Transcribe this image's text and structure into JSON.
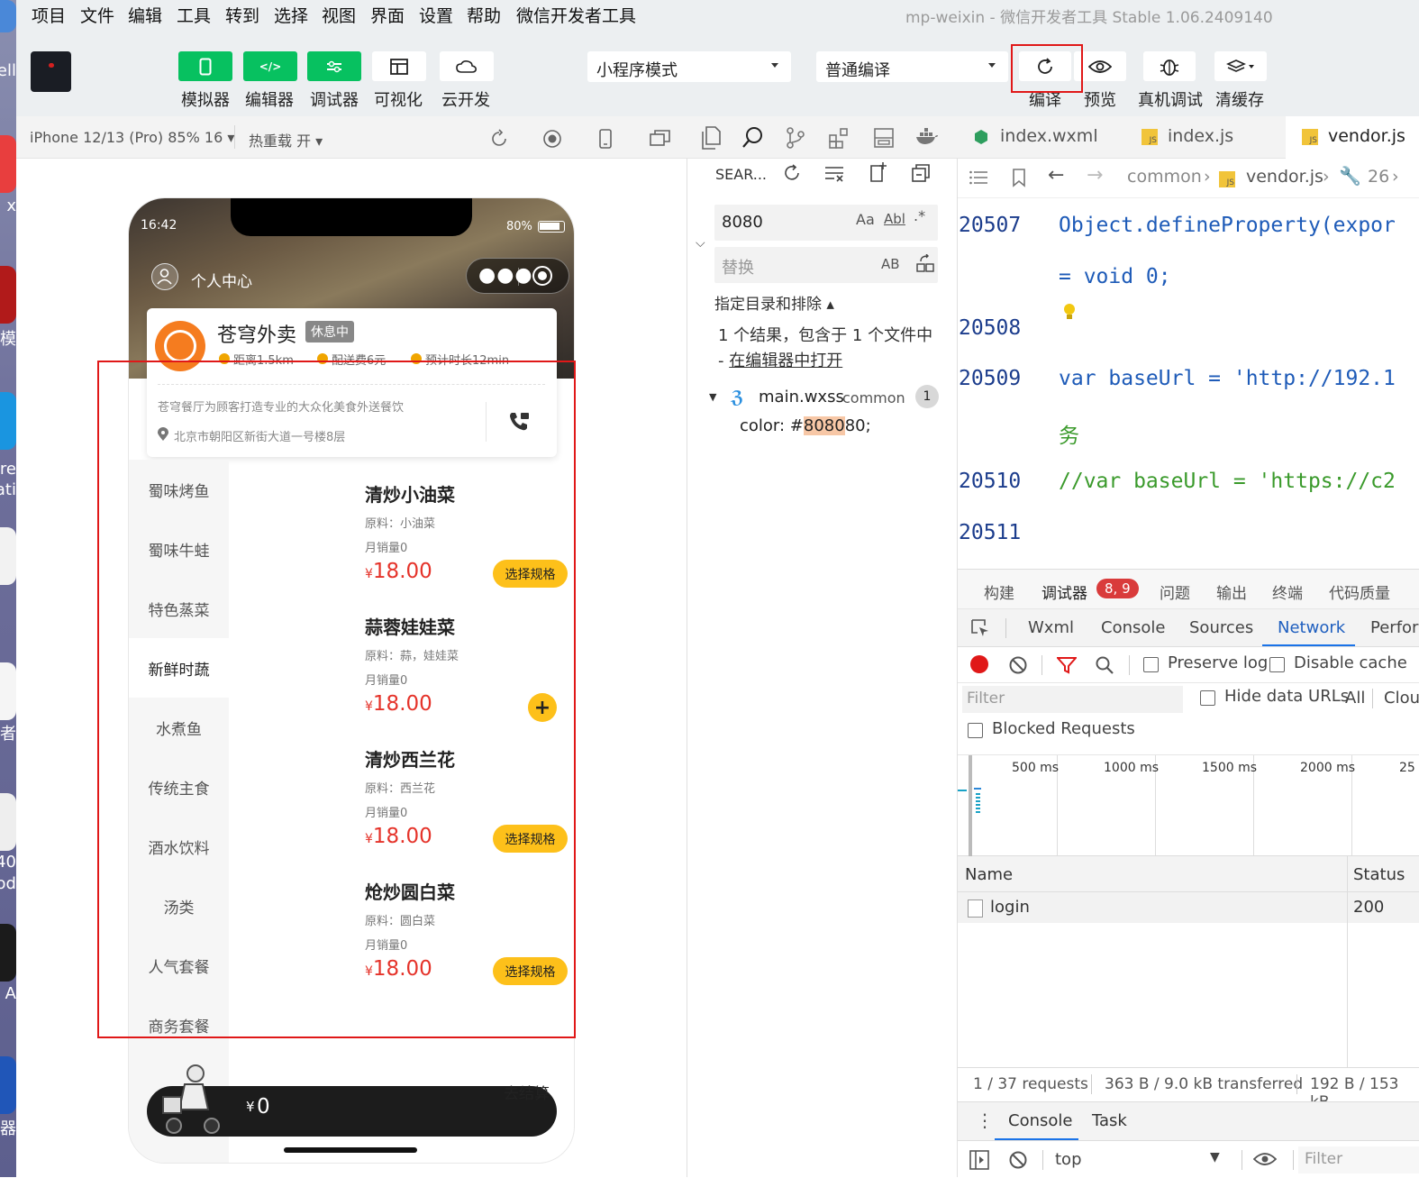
{
  "window": {
    "title": "mp-weixin - 微信开发者工具 Stable 1.06.2409140"
  },
  "menu": [
    "项目",
    "文件",
    "编辑",
    "工具",
    "转到",
    "选择",
    "视图",
    "界面",
    "设置",
    "帮助",
    "微信开发者工具"
  ],
  "dock": {
    "labels": [
      "ell",
      "x",
      "模",
      "re",
      "ati.",
      "者",
      "40",
      "od",
      "A",
      "器"
    ]
  },
  "toolbar": {
    "buttons": [
      "模拟器",
      "编辑器",
      "调试器",
      "可视化",
      "云开发"
    ],
    "mode_select": "小程序模式",
    "compile_select": "普通编译",
    "right_buttons": [
      "编译",
      "预览",
      "真机调试",
      "清缓存"
    ]
  },
  "simulator": {
    "device": "iPhone 12/13 (Pro) 85% 16",
    "hot_reload": "热重载 开",
    "status_time": "16:42",
    "battery": "80%",
    "nav_title": "个人中心",
    "shop": {
      "name": "苍穹外卖",
      "status": "休息中",
      "distance": "距离1.5km",
      "delivery_fee": "配送费6元",
      "eta": "预计时长12min",
      "desc": "苍穹餐厅为顾客打造专业的大众化美食外送餐饮",
      "address": "北京市朝阳区新街大道一号楼8层"
    },
    "categories": [
      "蜀味烤鱼",
      "蜀味牛蛙",
      "特色蒸菜",
      "新鲜时蔬",
      "水煮鱼",
      "传统主食",
      "酒水饮料",
      "汤类",
      "人气套餐",
      "商务套餐"
    ],
    "active_category": "新鲜时蔬",
    "dishes": [
      {
        "name": "清炒小油菜",
        "material": "原料：小油菜",
        "sales": "月销量0",
        "currency": "¥",
        "price": "18.00",
        "action": "选择规格"
      },
      {
        "name": "蒜蓉娃娃菜",
        "material": "原料：蒜，娃娃菜",
        "sales": "月销量0",
        "currency": "¥",
        "price": "18.00",
        "action": "+"
      },
      {
        "name": "清炒西兰花",
        "material": "原料：西兰花",
        "sales": "月销量0",
        "currency": "¥",
        "price": "18.00",
        "action": "选择规格"
      },
      {
        "name": "炝炒圆白菜",
        "material": "原料：圆白菜",
        "sales": "月销量0",
        "currency": "¥",
        "price": "18.00",
        "action": "选择规格"
      }
    ],
    "cart": {
      "currency": "¥",
      "total": "0",
      "checkout": "去结算"
    }
  },
  "explorer": {
    "search_label": "SEAR...",
    "search_value": "8080",
    "replace_placeholder": "替换",
    "match_case": "Aa",
    "whole_word": "Abl",
    "regex": ".*",
    "preserve_case": "AB",
    "include_exclude": "指定目录和排除",
    "result_summary": "1 个结果，包含于 1 个文件中 - ",
    "open_in_editor": "在编辑器中打开",
    "file": "main.wxss",
    "file_dir": "common",
    "file_count": "1",
    "match_prefix": "color: #",
    "match_hit": "8080",
    "match_suffix": "80;"
  },
  "editor": {
    "tabs": [
      "index.wxml",
      "index.js",
      "vendor.js"
    ],
    "breadcrumb": [
      "common",
      "vendor.js",
      "26"
    ],
    "lines": [
      {
        "no": "20507",
        "text": "Object.defineProperty(expor"
      },
      {
        "no": "",
        "text": "= void 0;"
      },
      {
        "no": "20508",
        "text": ""
      },
      {
        "no": "20509",
        "text": "var baseUrl = 'http://192.1"
      },
      {
        "no": "",
        "text": "务"
      },
      {
        "no": "20510",
        "text": "//var baseUrl = 'https://c2"
      },
      {
        "no": "20511",
        "text": ""
      }
    ]
  },
  "devtools": {
    "top_tabs": [
      "构建",
      "调试器",
      "问题",
      "输出",
      "终端",
      "代码质量"
    ],
    "badge": "8, 9",
    "panel_tabs": [
      "Wxml",
      "Console",
      "Sources",
      "Network",
      "Perfor"
    ],
    "active_panel": "Network",
    "preserve_log": "Preserve log",
    "disable_cache": "Disable cache",
    "filter_placeholder": "Filter",
    "hide_data_urls": "Hide data URLs",
    "all": "All",
    "clou": "Clou",
    "blocked": "Blocked Requests",
    "timeline_ticks": [
      "500 ms",
      "1000 ms",
      "1500 ms",
      "2000 ms",
      "25"
    ],
    "columns": [
      "Name",
      "Status"
    ],
    "rows": [
      {
        "name": "login",
        "status": "200"
      }
    ],
    "summary": [
      "1 / 37 requests",
      "363 B / 9.0 kB transferred",
      "192 B / 153 kB"
    ],
    "drawer_tabs": [
      "Console",
      "Task"
    ],
    "context": "top",
    "console_filter": "Filter"
  }
}
